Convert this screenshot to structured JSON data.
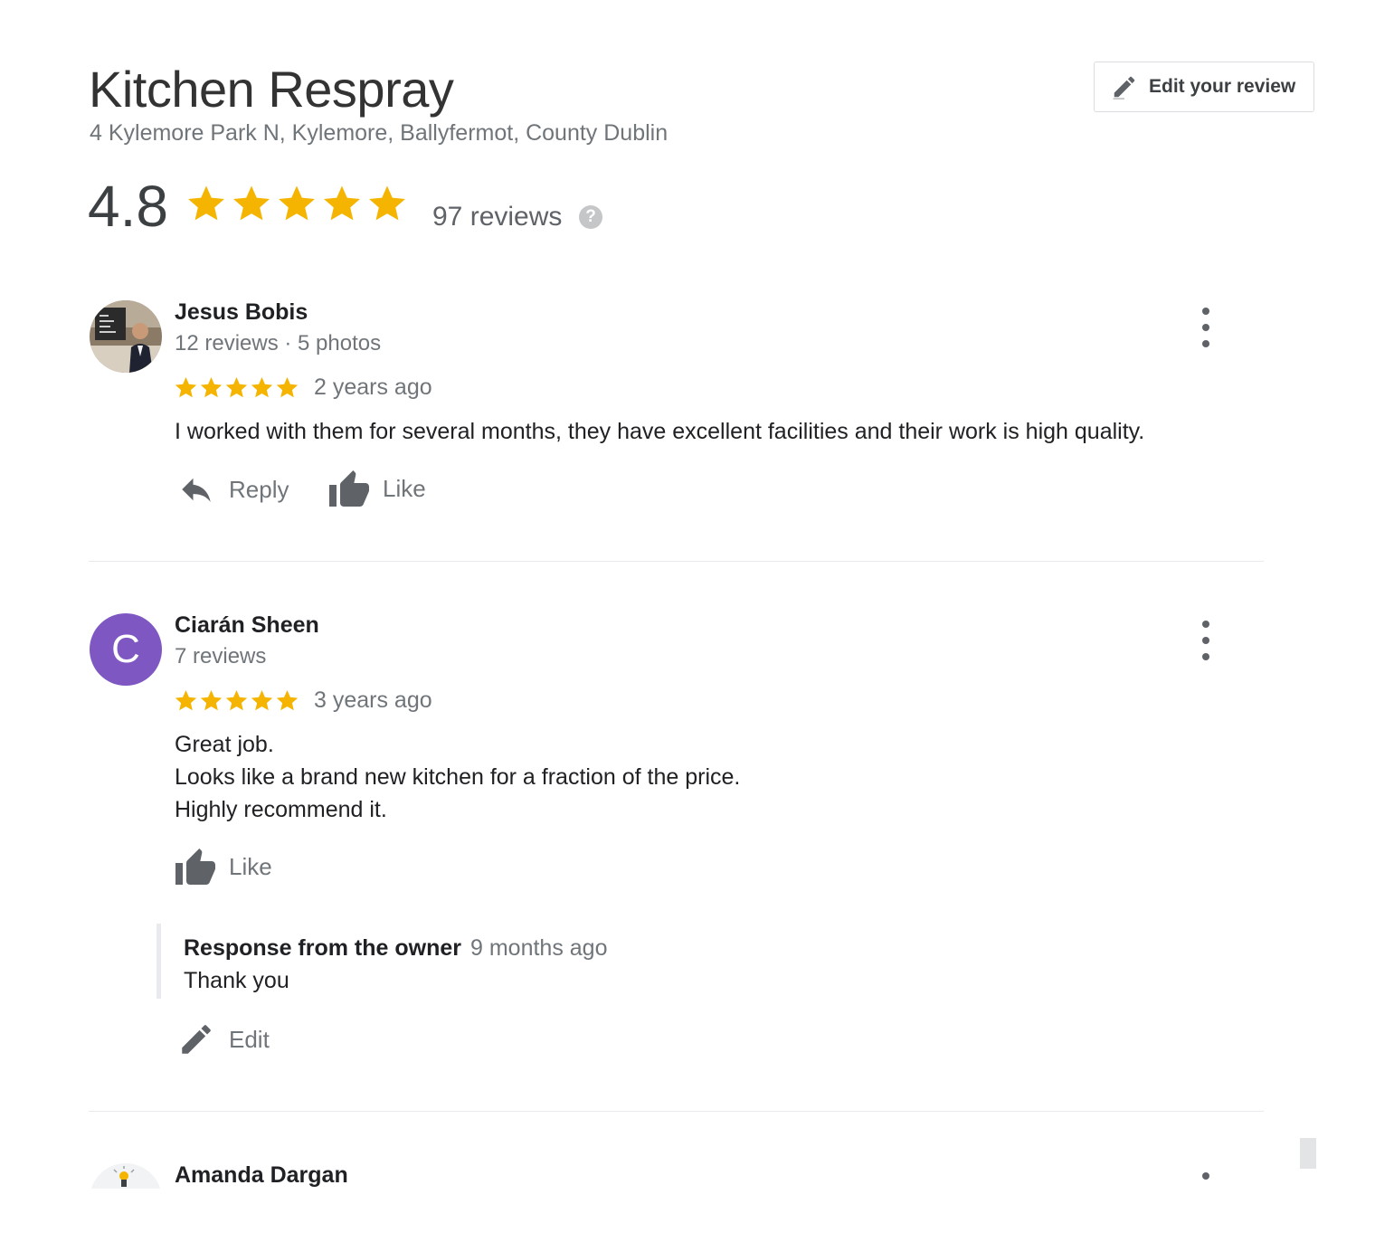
{
  "business": {
    "name": "Kitchen Respray",
    "address": "4 Kylemore Park N, Kylemore, Ballyfermot, County Dublin",
    "rating": "4.8",
    "stars": 5,
    "review_count_label": "97 reviews",
    "help_label": "?"
  },
  "header": {
    "edit_review_label": "Edit your review"
  },
  "colors": {
    "star": "#f4b400",
    "avatar_purple": "#7e57c2",
    "divider": "#e8eaed"
  },
  "reviews": [
    {
      "name": "Jesus Bobis",
      "meta": "12 reviews · 5 photos",
      "stars": 5,
      "time": "2 years ago",
      "text_lines": [
        "I worked with them for several months, they have excellent facilities and their work is high quality."
      ],
      "reply_label": "Reply",
      "like_label": "Like"
    },
    {
      "name": "Ciarán Sheen",
      "avatar_letter": "C",
      "meta": "7 reviews",
      "stars": 5,
      "time": "3 years ago",
      "text_lines": [
        "Great job.",
        "Looks like a brand new kitchen for a fraction of the price.",
        "Highly recommend it."
      ],
      "like_label": "Like",
      "owner_response": {
        "title": "Response from the owner",
        "time": "9 months ago",
        "text": "Thank you"
      },
      "edit_label": "Edit"
    },
    {
      "name": "Amanda Dargan"
    }
  ]
}
